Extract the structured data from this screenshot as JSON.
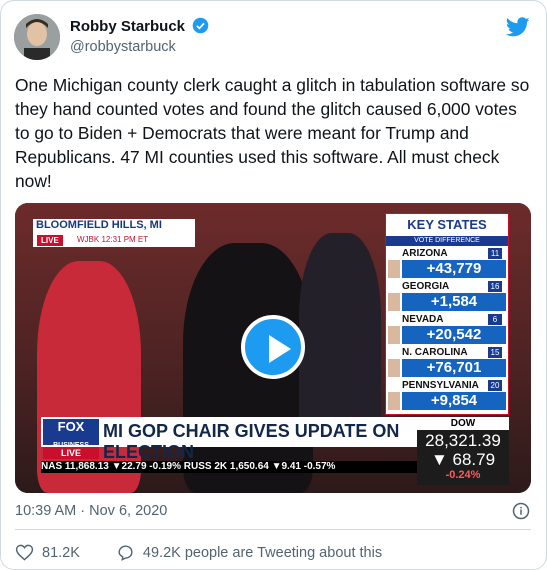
{
  "author": {
    "name": "Robby Starbuck",
    "handle": "@robbystarbuck"
  },
  "tweet": {
    "text": "One Michigan county clerk caught a glitch in tabulation software so they hand counted votes and found the glitch caused 6,000 votes to go to Biden + Democrats that were meant for Trump and Republicans. 47 MI counties used this software. All must check now!",
    "timestamp": "10:39 AM · Nov 6, 2020",
    "like_count": "81.2K",
    "retweet_text": "49.2K people are Tweeting about this"
  },
  "video": {
    "location": "BLOOMFIELD HILLS, MI",
    "live_label": "LIVE",
    "station": "WJBK  12:31 PM ET",
    "key_states_title": "KEY STATES",
    "vote_diff_label": "VOTE DIFFERENCE",
    "states": [
      {
        "name": "ARIZONA",
        "num": "11",
        "value": "+43,779"
      },
      {
        "name": "GEORGIA",
        "num": "16",
        "value": "+1,584"
      },
      {
        "name": "NEVADA",
        "num": "6",
        "value": "+20,542"
      },
      {
        "name": "N. CAROLINA",
        "num": "15",
        "value": "+76,701"
      },
      {
        "name": "PENNSYLVANIA",
        "num": "20",
        "value": "+9,854"
      }
    ],
    "fox_label": "FOX",
    "fox_sub": "BUSINESS",
    "fox_live": "LIVE",
    "headline": "MI GOP CHAIR GIVES UPDATE ON ELECTION",
    "ticker": "NAS    11,868.13 ▼22.79  -0.19%  RUSS 2K   1,650.64 ▼9.41  -0.57%",
    "dow_label": "DOW",
    "dow_value": "28,321.39",
    "dow_change": "▼ 68.79",
    "dow_pct": "-0.24%"
  },
  "colors": {
    "twitter_blue": "#1d9bf0",
    "fox_blue": "#1a3a8f",
    "fox_red": "#c8102e"
  }
}
